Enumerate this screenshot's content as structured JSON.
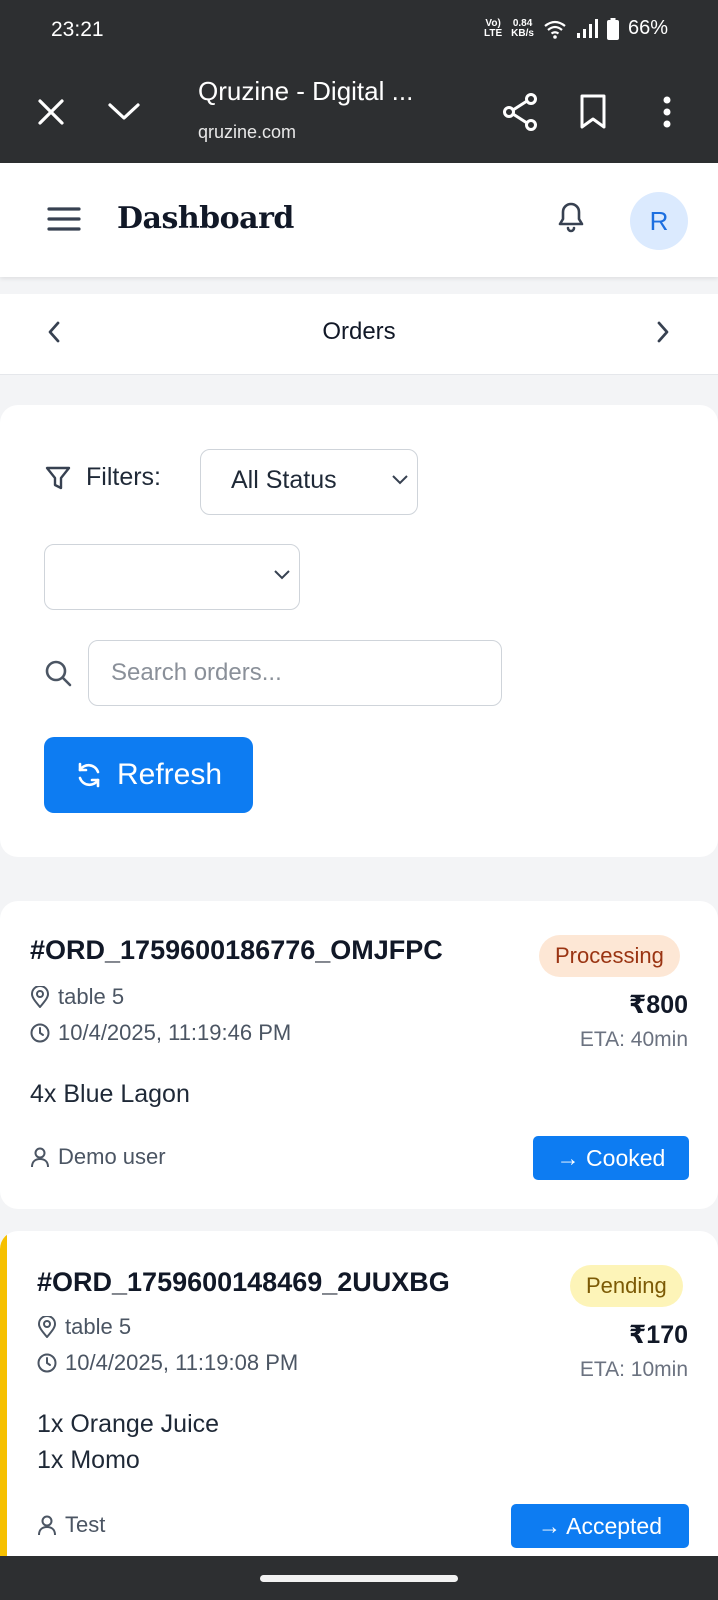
{
  "status_bar": {
    "time": "23:21",
    "net_top": "Vo) LTE",
    "speed_value": "0.84",
    "speed_unit": "KB/s",
    "battery": "66%"
  },
  "browser": {
    "title": "Qruzine - Digital ...",
    "domain": "qruzine.com"
  },
  "header": {
    "title": "Dashboard",
    "avatar_initial": "R"
  },
  "section_nav": {
    "label": "Orders"
  },
  "filters": {
    "label": "Filters:",
    "status_select": {
      "value": "All Status"
    },
    "second_select": {
      "value": ""
    },
    "search": {
      "placeholder": "Search orders..."
    },
    "refresh_label": "Refresh"
  },
  "orders": [
    {
      "id": "#ORD_1759600186776_OMJFPC",
      "table": "table 5",
      "datetime": "10/4/2025, 11:19:46 PM",
      "status": "Processing",
      "status_bg": "#fde7d5",
      "status_fg": "#9a3412",
      "price": "₹800",
      "eta": "ETA: 40min",
      "items": [
        "4x Blue Lagon"
      ],
      "user": "Demo user",
      "action": "→ Cooked"
    },
    {
      "id": "#ORD_1759600148469_2UUXBG",
      "table": "table 5",
      "datetime": "10/4/2025, 11:19:08 PM",
      "status": "Pending",
      "status_bg": "#fdf4b8",
      "status_fg": "#7c5a05",
      "price": "₹170",
      "eta": "ETA: 10min",
      "items": [
        "1x Orange Juice",
        "1x Momo"
      ],
      "user": "Test",
      "action": "→ Accepted"
    }
  ],
  "colors": {
    "primary": "#0d7cf2",
    "pending_accent": "#f6c000",
    "chrome": "#2d2f31"
  }
}
